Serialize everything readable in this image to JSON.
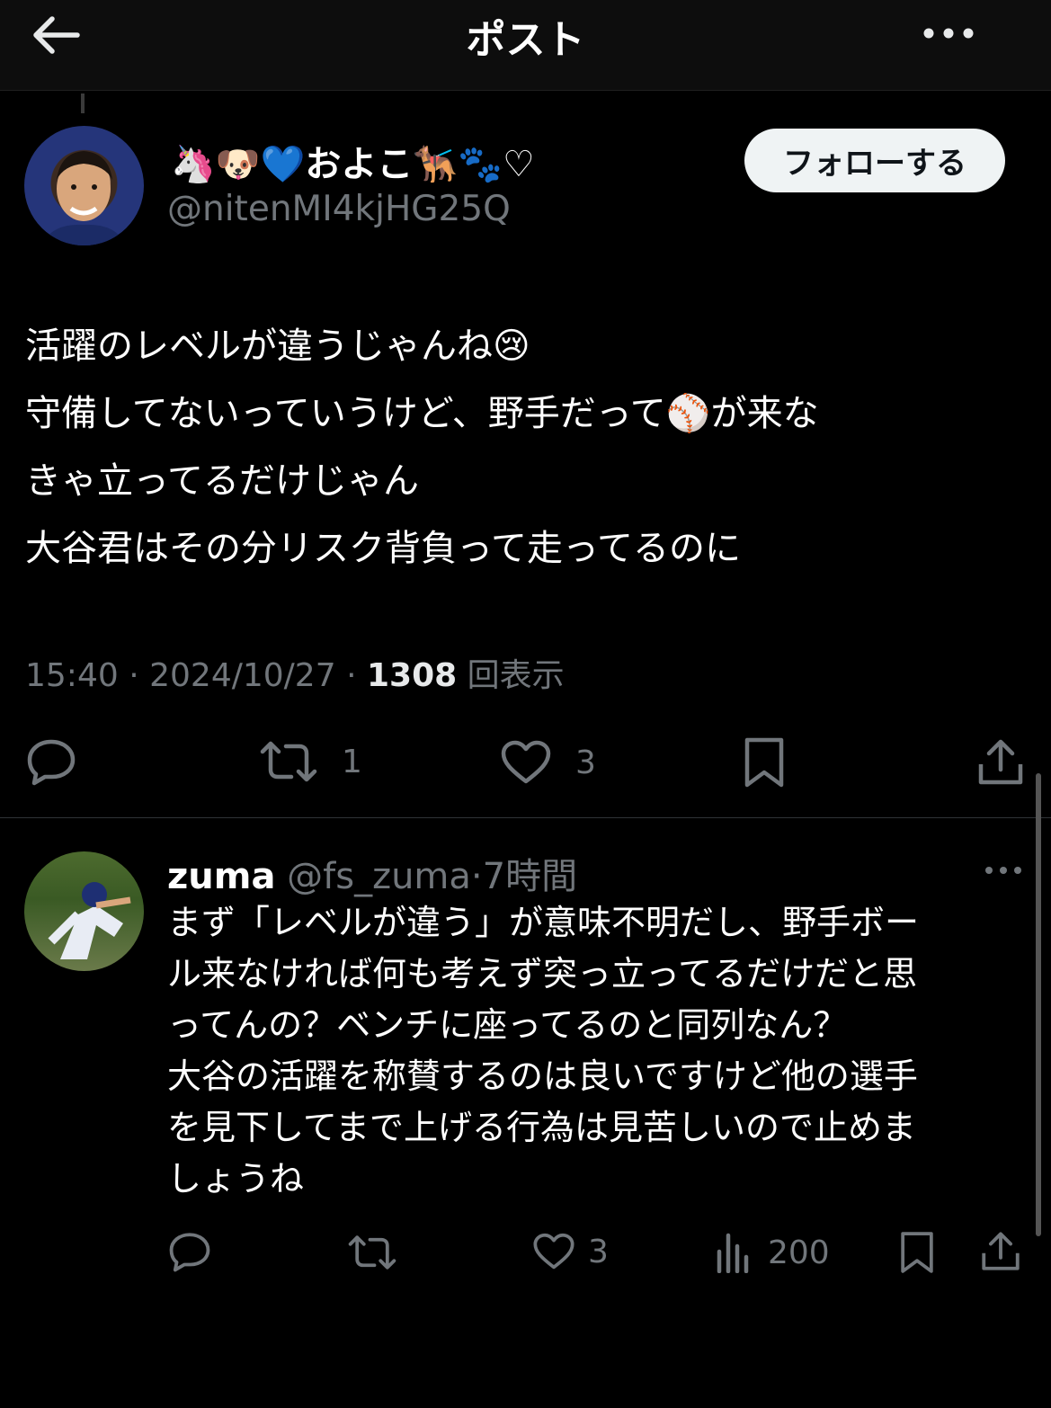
{
  "header": {
    "title": "ポスト",
    "back_icon": "arrow-left-icon",
    "more_icon": "more-horizontal-icon"
  },
  "post": {
    "author": {
      "display_name": "🦄🐶💙およこ🐕‍🦺🐾♡",
      "handle": "@nitenMI4kjHG25Q"
    },
    "follow_label": "フォローする",
    "text_lines": [
      "活躍のレベルが違うじゃんね😢",
      "守備してないっていうけど、野手だって⚾️が来な",
      "きゃ立ってるだけじゃん",
      "大谷君はその分リスク背負って走ってるのに"
    ],
    "meta": {
      "time": "15:40",
      "sep1": "·",
      "date": "2024/10/27",
      "sep2": "·",
      "views_count": "1308",
      "views_label": "回表示"
    },
    "actions": {
      "reply_icon": "reply-icon",
      "retweet_icon": "retweet-icon",
      "retweet_count": "1",
      "like_icon": "heart-icon",
      "like_count": "3",
      "bookmark_icon": "bookmark-icon",
      "share_icon": "share-icon"
    }
  },
  "reply": {
    "display_name": "zuma",
    "handle": "@fs_zuma",
    "sep": "·",
    "time": "7時間",
    "text_lines": [
      "まず「レベルが違う」が意味不明だし、野手ボー",
      "ル来なければ何も考えず突っ立ってるだけだと思",
      "ってんの？ベンチに座ってるのと同列なん？",
      "大谷の活躍を称賛するのは良いですけど他の選手",
      "を見下してまで上げる行為は見苦しいので止めま",
      "しょうね"
    ],
    "actions": {
      "like_count": "3",
      "views_count": "200"
    }
  },
  "colors": {
    "background": "#000000",
    "text": "#e7e9ea",
    "muted": "#71767b",
    "follow_bg": "#eff3f4"
  }
}
